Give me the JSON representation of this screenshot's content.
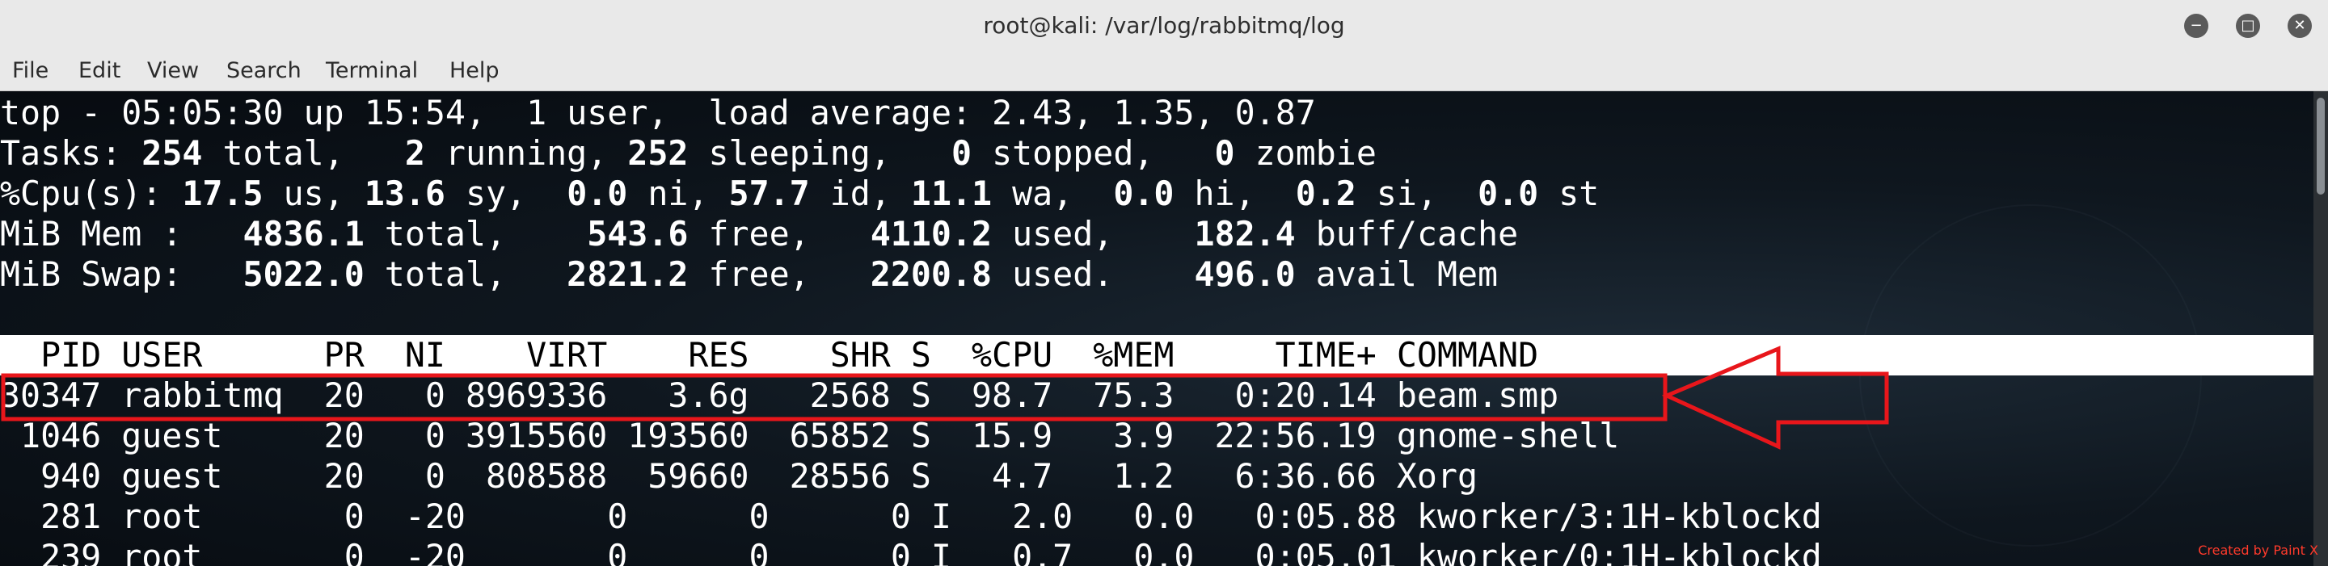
{
  "window": {
    "title": "root@kali: /var/log/rabbitmq/log",
    "minimize_icon": "minimize-icon",
    "maximize_icon": "maximize-icon",
    "close_icon": "close-icon"
  },
  "menu": [
    "File",
    "Edit",
    "View",
    "Search",
    "Terminal",
    "Help"
  ],
  "summary": {
    "time": "05:05:30",
    "uptime": "15:54",
    "users": "1",
    "load": [
      "2.43",
      "1.35",
      "0.87"
    ],
    "tasks": {
      "total": "254",
      "running": "2",
      "sleeping": "252",
      "stopped": "0",
      "zombie": "0"
    },
    "cpu": {
      "us": "17.5",
      "sy": "13.6",
      "ni": "0.0",
      "id": "57.7",
      "wa": "11.1",
      "hi": "0.0",
      "si": "0.2",
      "st": "0.0"
    },
    "mem": {
      "total": "4836.1",
      "free": "543.6",
      "used": "4110.2",
      "buff_cache": "182.4"
    },
    "swap": {
      "total": "5022.0",
      "free": "2821.2",
      "used": "2200.8",
      "avail_mem": "496.0"
    }
  },
  "process_header": "  PID USER      PR  NI    VIRT    RES    SHR S  %CPU  %MEM     TIME+ COMMAND",
  "processes": [
    {
      "pid": "30347",
      "user": "rabbitmq",
      "pr": "20",
      "ni": "0",
      "virt": "8969336",
      "res": "3.6g",
      "shr": "2568",
      "s": "S",
      "cpu": "98.7",
      "mem": "75.3",
      "time": "0:20.14",
      "command": "beam.smp"
    },
    {
      "pid": "1046",
      "user": "guest",
      "pr": "20",
      "ni": "0",
      "virt": "3915560",
      "res": "193560",
      "shr": "65852",
      "s": "S",
      "cpu": "15.9",
      "mem": "3.9",
      "time": "22:56.19",
      "command": "gnome-shell"
    },
    {
      "pid": "940",
      "user": "guest",
      "pr": "20",
      "ni": "0",
      "virt": "808588",
      "res": "59660",
      "shr": "28556",
      "s": "S",
      "cpu": "4.7",
      "mem": "1.2",
      "time": "6:36.66",
      "command": "Xorg"
    },
    {
      "pid": "281",
      "user": "root",
      "pr": "0",
      "ni": "-20",
      "virt": "0",
      "res": "0",
      "shr": "0",
      "s": "I",
      "cpu": "2.0",
      "mem": "0.0",
      "time": "0:05.88",
      "command": "kworker/3:1H-kblockd"
    },
    {
      "pid": "239",
      "user": "root",
      "pr": "0",
      "ni": "-20",
      "virt": "0",
      "res": "0",
      "shr": "0",
      "s": "I",
      "cpu": "0.7",
      "mem": "0.0",
      "time": "0:05.01",
      "command": "kworker/0:1H-kblockd"
    }
  ],
  "highlight": {
    "color": "#e8161b",
    "target_pid": "30347"
  },
  "credit": "Created by Paint X"
}
